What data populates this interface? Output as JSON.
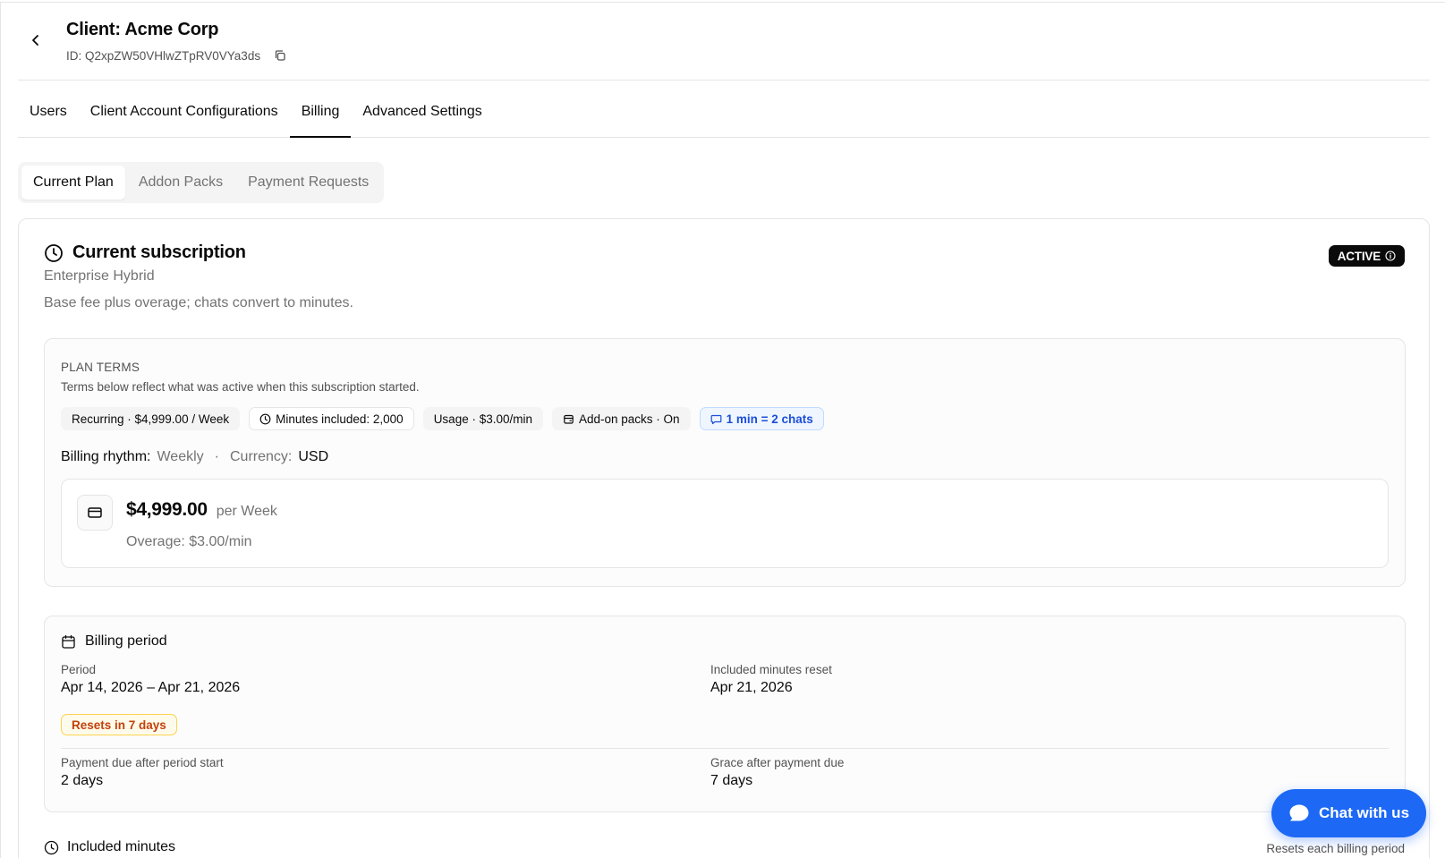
{
  "header": {
    "title": "Client: Acme Corp",
    "id_label": "ID: Q2xpZW50VHlwZTpRV0VYa3ds"
  },
  "main_tabs": [
    {
      "label": "Users"
    },
    {
      "label": "Client Account Configurations"
    },
    {
      "label": "Billing"
    },
    {
      "label": "Advanced Settings"
    }
  ],
  "sub_tabs": [
    {
      "label": "Current Plan"
    },
    {
      "label": "Addon Packs"
    },
    {
      "label": "Payment Requests"
    }
  ],
  "subscription": {
    "title": "Current subscription",
    "plan_name": "Enterprise Hybrid",
    "description": "Base fee plus overage; chats convert to minutes.",
    "status_badge": "ACTIVE"
  },
  "plan_terms": {
    "label": "PLAN TERMS",
    "note": "Terms below reflect what was active when this subscription started.",
    "chips": [
      "Recurring · $4,999.00 / Week",
      "Minutes included: 2,000",
      "Usage · $3.00/min",
      "Add-on packs · On",
      "1 min = 2 chats"
    ],
    "rhythm_label": "Billing rhythm:",
    "rhythm_value": "Weekly",
    "separator": "·",
    "currency_label": "Currency:",
    "currency_value": "USD",
    "price": "$4,999.00",
    "per": "per Week",
    "overage": "Overage: $3.00/min"
  },
  "billing_period": {
    "title": "Billing period",
    "period_label": "Period",
    "period_value": "Apr 14, 2026 – Apr 21, 2026",
    "reset_label": "Included minutes reset",
    "reset_value": "Apr 21, 2026",
    "resets_badge": "Resets in 7 days",
    "payment_due_label": "Payment due after period start",
    "payment_due_value": "2 days",
    "grace_label": "Grace after payment due",
    "grace_value": "7 days"
  },
  "included_minutes": {
    "title": "Included minutes",
    "note": "Resets each billing period"
  },
  "chat": {
    "label": "Chat with us"
  },
  "colors": {
    "accent_blue": "#1d68f5",
    "badge_dark": "#0a0a0a",
    "warning_text": "#c2410c",
    "info_chip_text": "#1d4ed8"
  }
}
